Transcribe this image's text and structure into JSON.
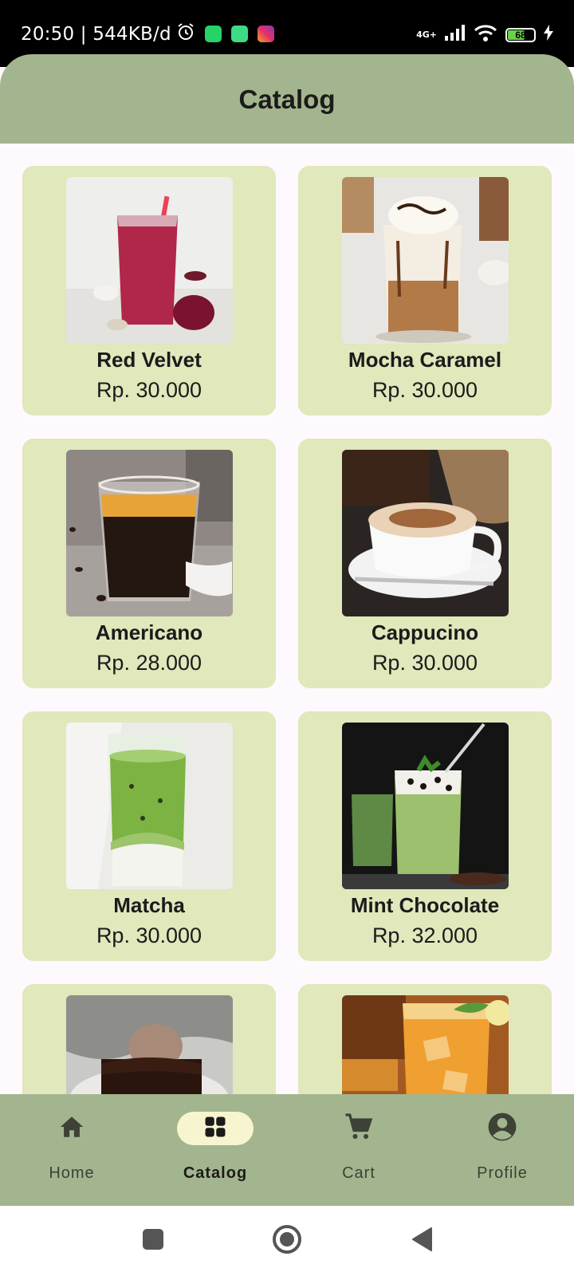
{
  "status_bar": {
    "time": "20:50 | 544KB/d",
    "network": "4G+",
    "battery": "68",
    "battery_level": 0.68,
    "app_icons": [
      "whatsapp-icon",
      "android-icon",
      "instagram-icon"
    ]
  },
  "app_bar": {
    "title": "Catalog"
  },
  "catalog": {
    "items": [
      {
        "name": "Red Velvet",
        "price": "Rp. 30.000",
        "image": "red-velvet-drink"
      },
      {
        "name": "Mocha Caramel",
        "price": "Rp. 30.000",
        "image": "mocha-caramel-drink"
      },
      {
        "name": "Americano",
        "price": "Rp. 28.000",
        "image": "americano-drink"
      },
      {
        "name": "Cappucino",
        "price": "Rp. 30.000",
        "image": "cappucino-drink"
      },
      {
        "name": "Matcha",
        "price": "Rp. 30.000",
        "image": "matcha-drink"
      },
      {
        "name": "Mint Chocolate",
        "price": "Rp. 32.000",
        "image": "mint-chocolate-drink"
      },
      {
        "name": "",
        "price": "",
        "image": "chocolate-dessert"
      },
      {
        "name": "",
        "price": "",
        "image": "iced-tea-drink"
      }
    ]
  },
  "bottom_nav": {
    "items": [
      {
        "label": "Home",
        "icon": "home-icon",
        "active": false
      },
      {
        "label": "Catalog",
        "icon": "grid-icon",
        "active": true
      },
      {
        "label": "Cart",
        "icon": "cart-icon",
        "active": false
      },
      {
        "label": "Profile",
        "icon": "profile-icon",
        "active": false
      }
    ]
  },
  "colors": {
    "app_bar": "#a3b58e",
    "card": "#e0e8bc",
    "active_pill": "#f7f5cf",
    "background": "#fdf9fd"
  }
}
